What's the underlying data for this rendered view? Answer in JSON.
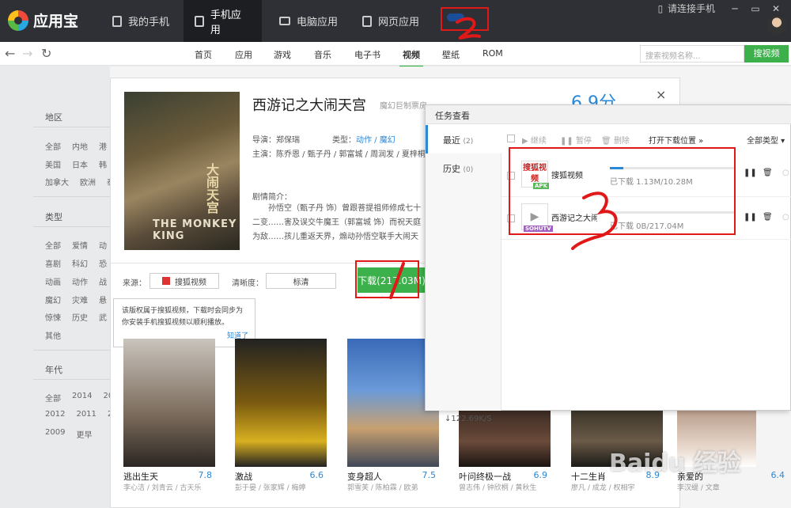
{
  "app": {
    "name": "应用宝"
  },
  "nav": {
    "tabs": [
      {
        "label": "我的手机",
        "icon": "phone-icon"
      },
      {
        "label": "手机应用",
        "icon": "app-icon",
        "active": true
      },
      {
        "label": "电脑应用",
        "icon": "monitor-icon"
      },
      {
        "label": "网页应用",
        "icon": "webpage-icon"
      }
    ]
  },
  "window": {
    "connect_label": "请连接手机",
    "controls": [
      "─",
      "▭",
      "✕"
    ]
  },
  "categories": [
    {
      "label": "首页"
    },
    {
      "label": "应用"
    },
    {
      "label": "游戏"
    },
    {
      "label": "音乐"
    },
    {
      "label": "电子书"
    },
    {
      "label": "视频",
      "active": true
    },
    {
      "label": "壁纸"
    },
    {
      "label": "ROM"
    }
  ],
  "search": {
    "placeholder": "搜索视频名称...",
    "button": "搜视频"
  },
  "filters": {
    "region": {
      "title": "地区",
      "rows": [
        [
          "全部",
          "内地",
          "港"
        ],
        [
          "美国",
          "日本",
          "韩"
        ],
        [
          "加拿大",
          "欧洲",
          "泰"
        ]
      ]
    },
    "type": {
      "title": "类型",
      "rows": [
        [
          "全部",
          "爱情",
          "动"
        ],
        [
          "喜剧",
          "科幻",
          "恐"
        ],
        [
          "动画",
          "动作",
          "战"
        ],
        [
          "魔幻",
          "灾难",
          "悬"
        ],
        [
          "惊悚",
          "历史",
          "武"
        ],
        [
          "其他"
        ]
      ]
    },
    "year": {
      "title": "年代",
      "rows": [
        [
          "全部",
          "2014",
          "20"
        ],
        [
          "2012",
          "2011",
          "20"
        ],
        [
          "2009",
          "更早"
        ]
      ]
    }
  },
  "detail": {
    "title": "西游记之大闹天宫",
    "subtitle": "魔幻巨制票房",
    "score": "6.9分",
    "poster_title": "大闹天宫",
    "poster_en": "THE MONKEY KING",
    "director_label": "导演：",
    "director": "郑保瑞",
    "genre_label": "类型：",
    "genre": "动作 / 魔幻",
    "cast_label": "主演：",
    "cast": "陈乔恩 / 甄子丹 / 郭富城 / 周润发 / 夏梓桐",
    "plot_label": "剧情简介：",
    "plot": "孙悟空（甄子丹 饰）曾跟菩提祖师修成七十二变……害及误交牛魔王（郭富城 饰）而祝天庭为敌……孩儿重返天界，煽动孙悟空联手大闹天庭，最终迫使",
    "source_label": "来源：",
    "source": "搜狐视频",
    "quality_label": "清晰度：",
    "quality": "标清",
    "download_button": "下载(217.03M)",
    "close": "×"
  },
  "tooltip": {
    "text": "该版权属于搜狐视频，下载时会同步为你安装手机搜狐视频以顺利播放。",
    "confirm": "知道了"
  },
  "movies": [
    {
      "name": "逃出生天",
      "score": "7.8",
      "actors": "李心洁 / 刘青云 / 古天乐"
    },
    {
      "name": "激战",
      "score": "6.6",
      "actors": "彭于晏 / 张家辉 / 梅婷"
    },
    {
      "name": "变身超人",
      "score": "7.5",
      "actors": "郭雪芙 / 陈柏霖 / 欧弟"
    },
    {
      "name": "叶问终极一战",
      "score": "6.9",
      "actors": "曾志伟 / 钟欣桐 / 黄秋生"
    },
    {
      "name": "十二生肖",
      "score": "8.9",
      "actors": "廖凡 / 成龙 / 权相宇"
    },
    {
      "name": "亲爱的",
      "score": "6.4",
      "actors": "李汉缇 / 文章"
    }
  ],
  "task_panel": {
    "title": "任务查看",
    "tabs": [
      {
        "label": "最近",
        "count": "(2)"
      },
      {
        "label": "历史",
        "count": "(0)"
      }
    ],
    "toolbar": {
      "resume": "继续",
      "pause": "暂停",
      "delete": "删除",
      "open_location": "打开下载位置 »",
      "type_filter": "全部类型"
    },
    "rows": [
      {
        "name": "搜狐视频",
        "icon_text": "搜狐视频",
        "tag": "APK",
        "status": "已下载 1.13M/10.28M",
        "progress": 0.11
      },
      {
        "name": "西游记之大闹天宫",
        "icon_text": "▶",
        "tag": "SOHUTV",
        "status": "已下载 0B/217.04M",
        "progress": 0.0
      }
    ],
    "speed": "↓122.69K/S"
  },
  "annotations": [
    "1",
    "2",
    "3"
  ],
  "watermark": "Baidu 经验"
}
